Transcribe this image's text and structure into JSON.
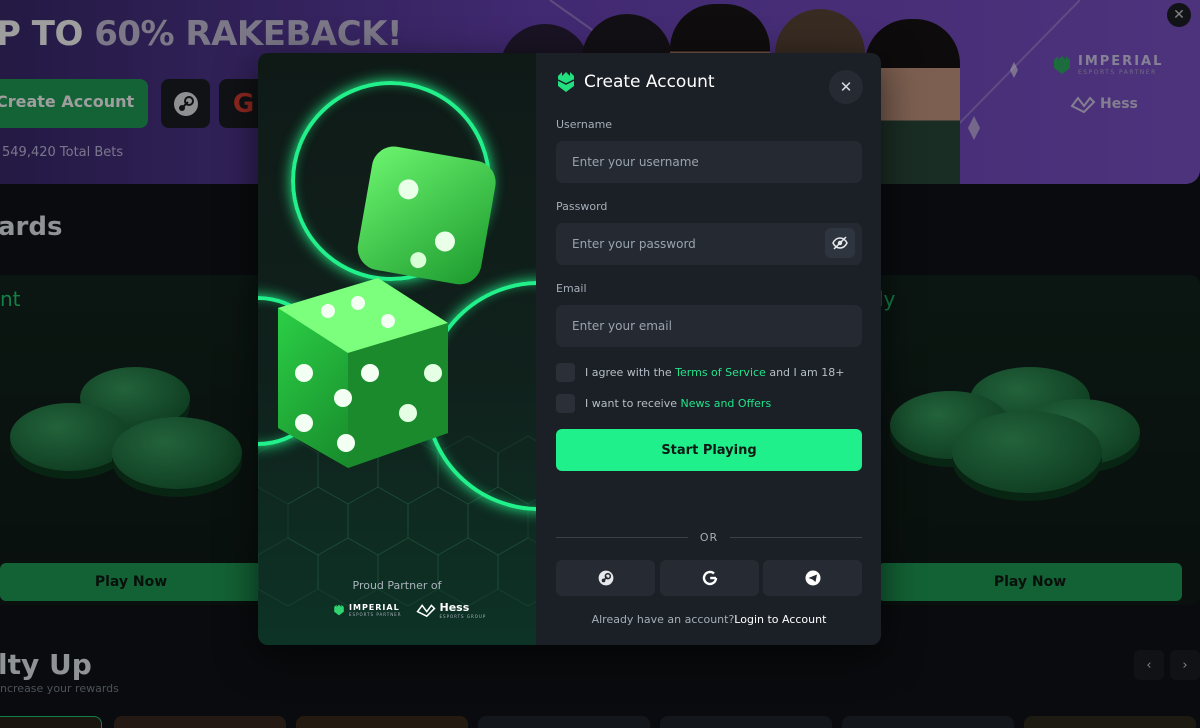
{
  "hero": {
    "title_part1": "P TO",
    "title_part2": "60% RAKEBACK!",
    "create_account": "Create Account",
    "total_bets": "549,420 Total Bets",
    "partner_name": "IMPERIAL",
    "partner_sub": "ESPORTS PARTNER",
    "hess": "Hess"
  },
  "rewards": {
    "title": "ards",
    "card_left_label": "nt",
    "card_right_label": "ly",
    "play_now": "Play Now"
  },
  "loyalty": {
    "title": "lty Up",
    "subtitle": "ncrease your rewards"
  },
  "modal": {
    "title": "Create Account",
    "username_label": "Username",
    "username_placeholder": "Enter your username",
    "password_label": "Password",
    "password_placeholder": "Enter your password",
    "email_label": "Email",
    "email_placeholder": "Enter your email",
    "terms_prefix": "I agree with the",
    "terms_link": "Terms of Service",
    "terms_suffix": "and I am 18+",
    "news_prefix": "I want to receive",
    "news_link": "News and Offers",
    "start_button": "Start Playing",
    "or": "OR",
    "login_prefix": "Already have an account?",
    "login_link": "Login to Account",
    "partner_label": "Proud Partner of",
    "partner1_name": "IMPERIAL",
    "partner1_sub": "ESPORTS PARTNER",
    "partner2_name": "Hess",
    "partner2_sub": "ESPORTS GROUP"
  },
  "colors": {
    "accent": "#1ff08c",
    "hero_purple": "#7d52c9",
    "modal_bg": "#1b1f26"
  },
  "icons": [
    "steam-icon",
    "google-icon",
    "telegram-icon",
    "close-icon",
    "eye-off-icon",
    "brand-logo-icon",
    "dice-image"
  ]
}
